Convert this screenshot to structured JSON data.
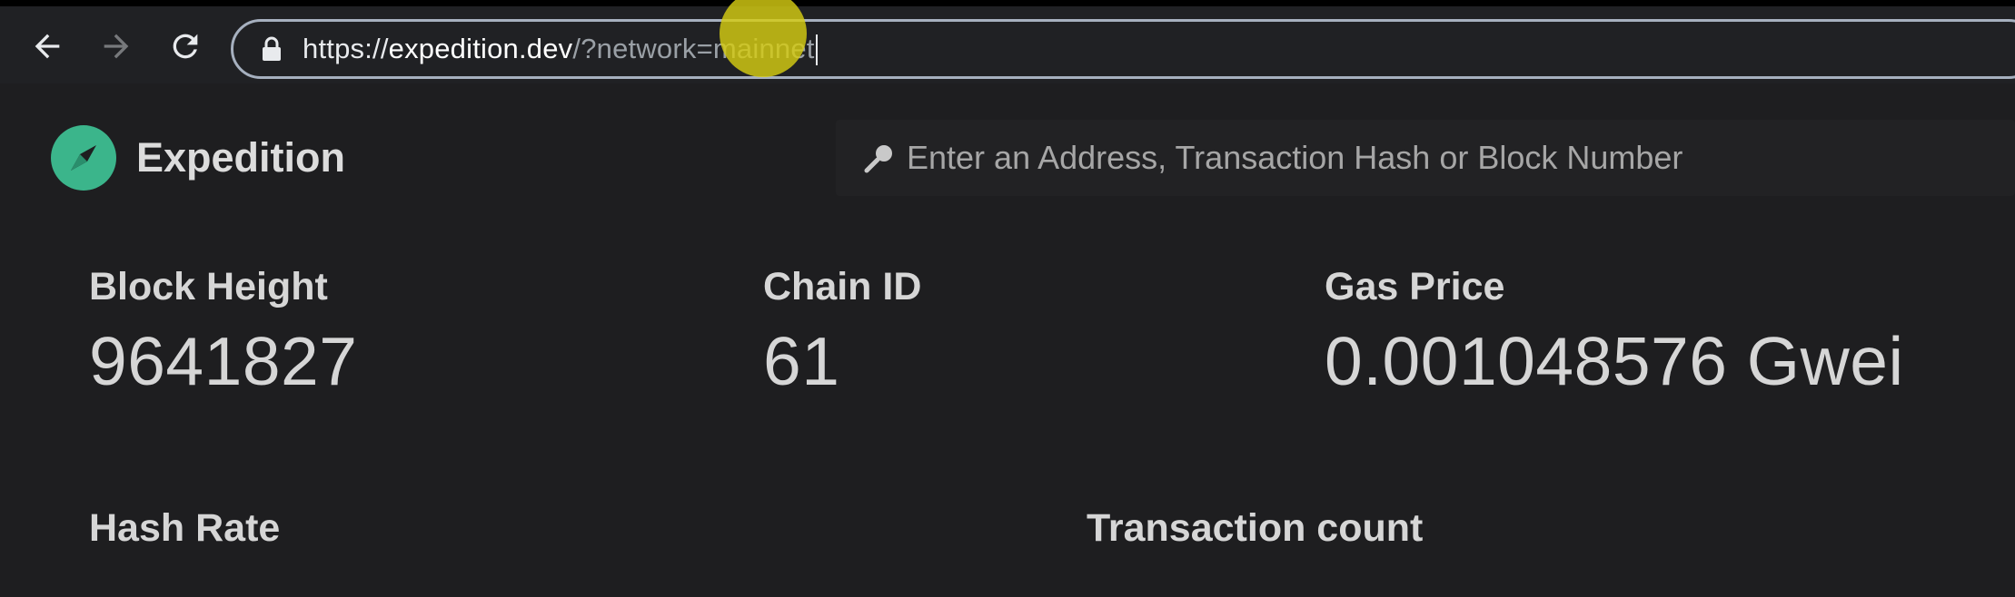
{
  "browser": {
    "url_scheme": "https://",
    "url_host": "expedition.dev",
    "url_path": "/?network=mainnet",
    "icons": {
      "back": "arrow-left-icon",
      "forward": "arrow-right-icon",
      "reload": "reload-icon",
      "lock": "lock-icon"
    }
  },
  "app": {
    "title": "Expedition",
    "logo_icon": "compass-icon",
    "accent_color": "#3bb58b"
  },
  "search": {
    "placeholder": "Enter an Address, Transaction Hash or Block Number",
    "icon": "search-icon"
  },
  "stats": {
    "block_height": {
      "label": "Block Height",
      "value": "9641827"
    },
    "chain_id": {
      "label": "Chain ID",
      "value": "61"
    },
    "gas_price": {
      "label": "Gas Price",
      "value": "0.001048576 Gwei"
    },
    "hash_rate": {
      "label": "Hash Rate"
    },
    "transaction_count": {
      "label": "Transaction count"
    }
  }
}
